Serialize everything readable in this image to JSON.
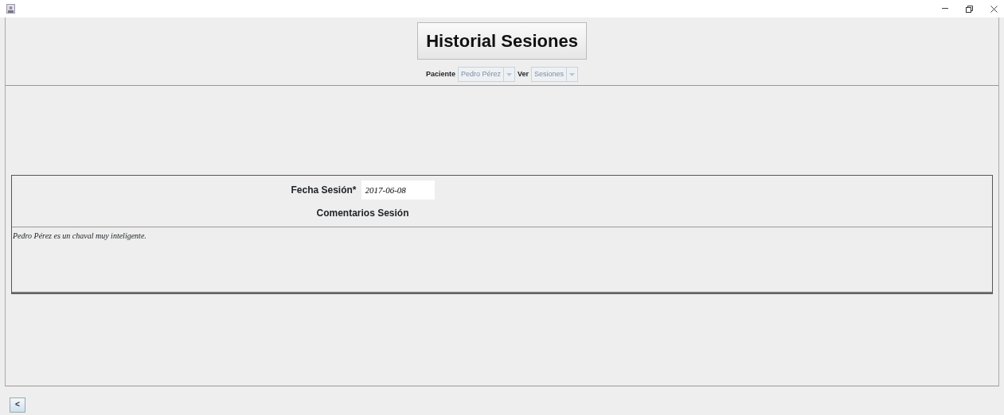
{
  "header": {
    "title": "Historial Sesiones"
  },
  "filters": [
    {
      "label": "Paciente",
      "value": "Pedro Pérez",
      "disabled": true
    },
    {
      "label": "Ver",
      "value": "Sesiones",
      "disabled": true
    }
  ],
  "session": {
    "date_label": "Fecha Sesión*",
    "date_value": "2017-06-08",
    "comments_label": "Comentarios Sesión",
    "comments": "Pedro Pérez es un chaval muy inteligente."
  },
  "footer": {
    "back_button": "<"
  }
}
